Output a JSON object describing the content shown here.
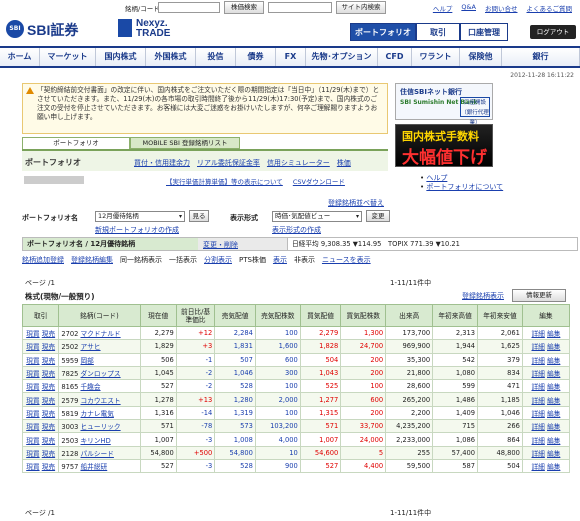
{
  "topbar": {
    "code_label": "銘柄/コード",
    "search_btn": "株価検索",
    "site_search_btn": "サイト内検索",
    "links": [
      "ヘルプ",
      "Q&A",
      "お問い合せ",
      "よくあるご質問"
    ]
  },
  "logo": {
    "sbi_mark": "SBI",
    "brand": "SBI証券",
    "partner": "Nexyz.",
    "partner_sub": "TRADE"
  },
  "mainbtns": {
    "portfolio": "ポートフォリオ",
    "trade": "取引",
    "account": "口座管理",
    "logout": "ログアウト"
  },
  "nav": [
    "ホーム",
    "マーケット",
    "国内株式",
    "外国株式",
    "投信",
    "債券",
    "FX",
    "先物･オプション",
    "CFD",
    "ワラント",
    "保険他",
    "銀行"
  ],
  "datetime": "2012-11-28 16:11:22",
  "notice": "「契約締結前交付書面」の改定に伴い、国内株式をご注文いただく際の期間指定は「当日中」（11/29(木)まで）とさせていただきます。また、11/29(木)の各市場の取引時間終了後から11/29(木)17:30(予定)まで、国内株式のご注文の受付を停止させていただきます。お客様には大変ご迷惑をお掛けいたしますが、何卒ご理解賜りますようお願い申し上げます。",
  "ad1": {
    "title": "住信SBIネット銀行",
    "sub": "SBI Sumishin Net Bank",
    "btn": "口座開設（銀行代理業）"
  },
  "ad2": {
    "line1": "国内株式手数料",
    "line2": "大幅値下げ"
  },
  "ptabs": {
    "tab1": "ポートフォリオ",
    "tab2": "MOBILE SBI 登録銘柄リスト"
  },
  "ptitle": "ポートフォリオ",
  "plinks": [
    "買付・信用建余力",
    "リアル委託保証金率",
    "信用シミュレーター",
    "株価"
  ],
  "acctlinks": [
    "【実行単価計算単価】等の表示について",
    "CSVダウンロード"
  ],
  "help": [
    "ヘルプ",
    "ポートフォリオについて"
  ],
  "sortlink": "登録銘柄並べ替え",
  "form": {
    "port_label": "ポートフォリオ名",
    "port_value": "12月優待銘柄",
    "view_btn": "見る",
    "disp_label": "表示形式",
    "disp_value": "時価･気配値ビュー",
    "change_btn": "変更",
    "new_link": "新規ポートフォリオの作成",
    "disp_link": "表示形式の作成"
  },
  "pnbar": {
    "name": "ポートフォリオ名 / 12月優待銘柄",
    "edit": "変更・削除",
    "idx": "日経平均 9,308.35 ▼114.95　TOPIX 771.39 ▼10.21"
  },
  "actions": [
    "銘柄追加登録",
    "登録銘柄編集",
    "同一銘柄表示",
    "一括表示",
    "分割表示",
    "PTS株価",
    "表示",
    "非表示",
    "ニュースを表示"
  ],
  "paging": {
    "page": "ページ /1",
    "count": "1-11/11件中"
  },
  "section_title": "株式(現物/一般預り)",
  "detail_link": "登録銘柄表示",
  "info_btn": "情報更新",
  "table": {
    "headers": [
      "取引",
      "銘柄(コード)",
      "現在値",
      "前日比/基準価比",
      "売気配値",
      "売気配株数",
      "買気配値",
      "買気配株数",
      "出来高",
      "年初来高値",
      "年初来安値",
      "編集"
    ],
    "rows": [
      [
        "2702",
        "マクドナルド",
        "2,279",
        "+12",
        "2,284",
        "100",
        "2,279",
        "1,300",
        "173,700",
        "2,313",
        "2,061"
      ],
      [
        "2502",
        "アサヒ",
        "1,829",
        "+3",
        "1,831",
        "1,600",
        "1,828",
        "24,700",
        "969,900",
        "1,944",
        "1,625"
      ],
      [
        "5959",
        "岡部",
        "506",
        "-1",
        "507",
        "600",
        "504",
        "200",
        "35,300",
        "542",
        "379"
      ],
      [
        "7825",
        "ダンロップス",
        "1,045",
        "-2",
        "1,046",
        "300",
        "1,043",
        "200",
        "21,800",
        "1,080",
        "834"
      ],
      [
        "8165",
        "千趣会",
        "527",
        "-2",
        "528",
        "100",
        "525",
        "100",
        "28,600",
        "599",
        "471"
      ],
      [
        "2579",
        "コカウエスト",
        "1,278",
        "+13",
        "1,280",
        "2,000",
        "1,277",
        "600",
        "265,200",
        "1,486",
        "1,185"
      ],
      [
        "5819",
        "カナレ電気",
        "1,316",
        "-14",
        "1,319",
        "100",
        "1,315",
        "200",
        "2,200",
        "1,409",
        "1,046"
      ],
      [
        "3003",
        "ヒューリック",
        "571",
        "-78",
        "573",
        "103,200",
        "571",
        "33,700",
        "4,235,200",
        "715",
        "266"
      ],
      [
        "2503",
        "キリンHD",
        "1,007",
        "-3",
        "1,008",
        "4,000",
        "1,007",
        "24,000",
        "2,233,000",
        "1,086",
        "864"
      ],
      [
        "2128",
        "パルシード",
        "54,800",
        "+500",
        "54,800",
        "10",
        "54,600",
        "5",
        "255",
        "57,400",
        "48,800"
      ],
      [
        "9757",
        "船井総研",
        "527",
        "-3",
        "528",
        "900",
        "527",
        "4,400",
        "59,500",
        "587",
        "504"
      ]
    ],
    "trade_buy": "現買",
    "trade_sell": "現売",
    "edit_detail": "詳細",
    "edit_edit": "編集"
  },
  "colors": {
    "brand": "#1a3a8a",
    "header_green": "#d8ead0",
    "up": "#e00000",
    "link": "#1a3fae"
  }
}
